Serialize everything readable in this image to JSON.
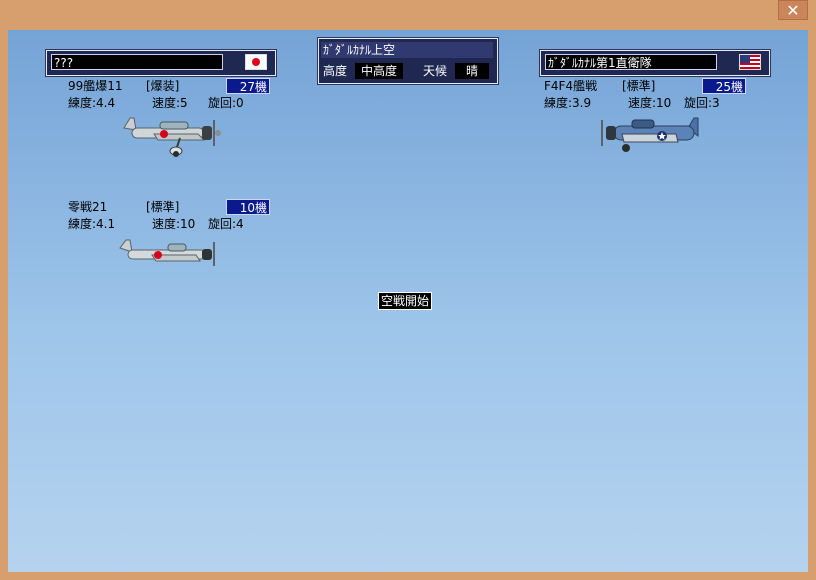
{
  "window": {
    "close_label": "✕"
  },
  "center": {
    "title": "ｶﾞﾀﾞﾙｶﾅﾙ上空",
    "altitude_label": "高度",
    "altitude_value": "中高度",
    "weather_label": "天候",
    "weather_value": "晴"
  },
  "left_side": {
    "commander": "???",
    "flag_icon": "japan-flag",
    "groups": [
      {
        "aircraft": "99艦爆11",
        "loadout": "[爆装]",
        "count": "27機",
        "skill": "練度:4.4",
        "speed": "速度:5",
        "turn": "旋回:0"
      },
      {
        "aircraft": "零戦21",
        "loadout": "[標準]",
        "count": "10機",
        "skill": "練度:4.1",
        "speed": "速度:10",
        "turn": "旋回:4"
      }
    ]
  },
  "right_side": {
    "unit_name": "ｶﾞﾀﾞﾙｶﾅﾙ第1直衛隊",
    "flag_icon": "usa-flag",
    "groups": [
      {
        "aircraft": "F4F4艦戦",
        "loadout": "[標準]",
        "count": "25機",
        "skill": "練度:3.9",
        "speed": "速度:10",
        "turn": "旋回:3"
      }
    ]
  },
  "message": "空戦開始",
  "colors": {
    "panel_bg": "#1f2850",
    "count_bg": "#0a1a8c",
    "sky_top": "#74a3d6",
    "sky_bottom": "#b5d3ef",
    "frame": "#d79f6e"
  }
}
